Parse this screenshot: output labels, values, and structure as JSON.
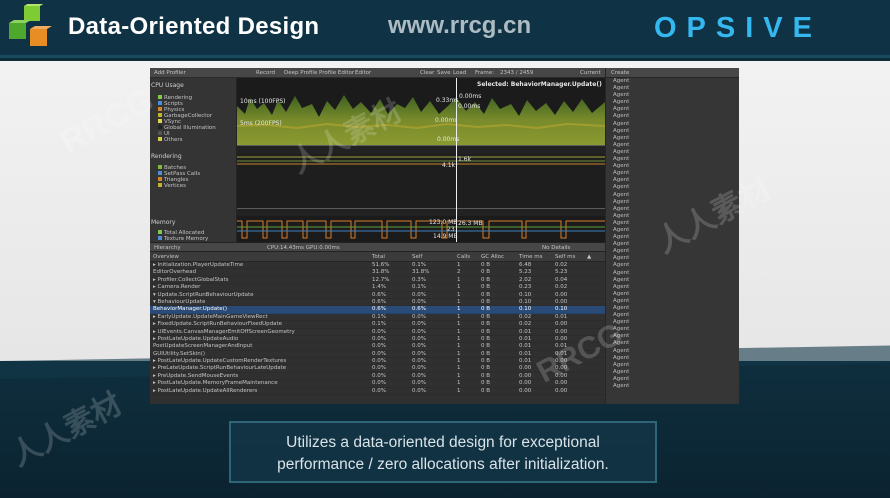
{
  "slide": {
    "title": "Data-Oriented Design",
    "site": "www.rrcg.cn",
    "brand": "OPSIVE",
    "caption_line1": "Utilizes a data-oriented design for exceptional",
    "caption_line2": "performance / zero allocations after initialization.",
    "watermarks": [
      "RRCG",
      "人人素材"
    ]
  },
  "profiler": {
    "toolbar": {
      "add_profiler": "Add Profiler",
      "record": "Record",
      "deep_profile": "Deep Profile",
      "profile_editor": "Profile Editor",
      "editor": "Editor",
      "clear": "Clear",
      "save": "Save",
      "load": "Load",
      "frame": "Frame:",
      "frame_value": "2343 / 2459",
      "current": "Current"
    },
    "side": {
      "cpu_usage": "CPU Usage",
      "cpu_items": [
        "Rendering",
        "Scripts",
        "Physics",
        "GarbageCollector",
        "VSync",
        "Global Illumination",
        "UI",
        "Others"
      ],
      "rendering": "Rendering",
      "render_items": [
        "Batches",
        "SetPass Calls",
        "Triangles",
        "Vertices"
      ],
      "memory": "Memory",
      "memory_items": [
        "Total Allocated",
        "Texture Memory"
      ]
    },
    "graph": {
      "label_100fps": "10ms (100FPS)",
      "label_200fps": "5ms (200FPS)",
      "selected": "Selected: BehaviorManager.Update()",
      "values": [
        "0.00ms",
        "0.33ms",
        "0.00ms",
        "0.00ms",
        "0.00ms",
        "0.00ms",
        "1.6k",
        "4.1k"
      ],
      "memory_values": [
        "123.0 MB",
        "26.3 MB",
        "14.9 MB",
        "23"
      ]
    },
    "table_bar": {
      "view": "Hierarchy",
      "cpu_gpu": "CPU:14.43ms   GPU:0.00ms",
      "no_details": "No Details"
    },
    "columns": [
      "Overview",
      "Total",
      "Self",
      "Calls",
      "GC Alloc",
      "Time ms",
      "Self ms"
    ],
    "rows": [
      [
        "▸ Initialization.PlayerUpdateTime",
        "51.6%",
        "0.1%",
        "1",
        "0 B",
        "6.48",
        "0.02"
      ],
      [
        "  EditorOverhead",
        "31.8%",
        "31.8%",
        "2",
        "0 B",
        "5.23",
        "5.23"
      ],
      [
        "▸ Profiler.CollectGlobalStats",
        "12.7%",
        "0.3%",
        "1",
        "0 B",
        "2.02",
        "0.04"
      ],
      [
        "▸ Camera.Render",
        "1.4%",
        "0.1%",
        "1",
        "0 B",
        "0.23",
        "0.02"
      ],
      [
        "▾ Update.ScriptRunBehaviourUpdate",
        "0.6%",
        "0.0%",
        "1",
        "0 B",
        "0.10",
        "0.00"
      ],
      [
        "  ▾ BehaviourUpdate",
        "0.6%",
        "0.0%",
        "1",
        "0 B",
        "0.10",
        "0.00"
      ],
      [
        "      BehaviorManager.Update()",
        "0.6%",
        "0.6%",
        "1",
        "0 B",
        "0.10",
        "0.10"
      ],
      [
        "▸ EarlyUpdate.UpdateMainGameViewRect",
        "0.1%",
        "0.0%",
        "1",
        "0 B",
        "0.02",
        "0.01"
      ],
      [
        "▸ FixedUpdate.ScriptRunBehaviourFixedUpdate",
        "0.1%",
        "0.0%",
        "1",
        "0 B",
        "0.02",
        "0.00"
      ],
      [
        "▸ UIEvents.CanvasManagerEmitOffScreenGeometry",
        "0.0%",
        "0.0%",
        "1",
        "0 B",
        "0.01",
        "0.00"
      ],
      [
        "▸ PostLateUpdate.UpdateAudio",
        "0.0%",
        "0.0%",
        "1",
        "0 B",
        "0.01",
        "0.00"
      ],
      [
        "  PostUpdateScreenManagerAndInput",
        "0.0%",
        "0.0%",
        "1",
        "0 B",
        "0.01",
        "0.01"
      ],
      [
        "  GUIUtility.SetSkin()",
        "0.0%",
        "0.0%",
        "1",
        "0 B",
        "0.01",
        "0.01"
      ],
      [
        "▸ PostLateUpdate.UpdateCustomRenderTextures",
        "0.0%",
        "0.0%",
        "1",
        "0 B",
        "0.01",
        "0.00"
      ],
      [
        "▸ PreLateUpdate.ScriptRunBehaviourLateUpdate",
        "0.0%",
        "0.0%",
        "1",
        "0 B",
        "0.00",
        "0.00"
      ],
      [
        "▸ PreUpdate.SendMouseEvents",
        "0.0%",
        "0.0%",
        "1",
        "0 B",
        "0.00",
        "0.00"
      ],
      [
        "▸ PostLateUpdate.MemoryFrameMaintenance",
        "0.0%",
        "0.0%",
        "1",
        "0 B",
        "0.00",
        "0.00"
      ],
      [
        "▸ PostLateUpdate.UpdateAllRenderers",
        "0.0%",
        "0.0%",
        "1",
        "0 B",
        "0.00",
        "0.00"
      ]
    ],
    "inspector": {
      "create": "Create",
      "agent": "Agent",
      "agent_count": 44
    }
  },
  "colors": {
    "brand": "#35b8f0",
    "selected_row": "#2a4b78",
    "graph_green": "#8a9930"
  }
}
